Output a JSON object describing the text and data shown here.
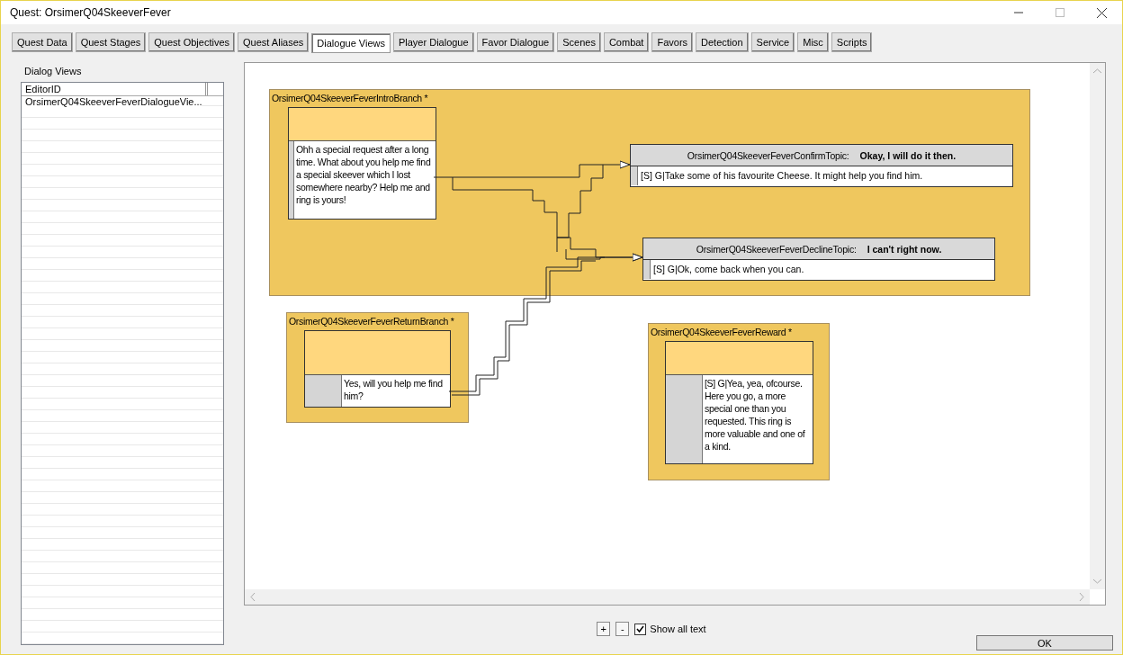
{
  "window": {
    "title": "Quest: OrsimerQ04SkeeverFever"
  },
  "tabs": [
    {
      "label": "Quest Data",
      "selected": false
    },
    {
      "label": "Quest Stages",
      "selected": false
    },
    {
      "label": "Quest Objectives",
      "selected": false
    },
    {
      "label": "Quest Aliases",
      "selected": false
    },
    {
      "label": "Dialogue Views",
      "selected": true
    },
    {
      "label": "Player Dialogue",
      "selected": false
    },
    {
      "label": "Favor Dialogue",
      "selected": false
    },
    {
      "label": "Scenes",
      "selected": false
    },
    {
      "label": "Combat",
      "selected": false
    },
    {
      "label": "Favors",
      "selected": false
    },
    {
      "label": "Detection",
      "selected": false
    },
    {
      "label": "Service",
      "selected": false
    },
    {
      "label": "Misc",
      "selected": false
    },
    {
      "label": "Scripts",
      "selected": false
    }
  ],
  "dialog_views": {
    "label": "Dialog Views",
    "columns": [
      "EditorID"
    ],
    "rows": [
      {
        "editor_id": "OrsimerQ04SkeeverFeverDialogueVie...",
        "selected": false
      }
    ]
  },
  "canvas": {
    "branches": [
      {
        "title": "OrsimerQ04SkeeverFeverIntroBranch *",
        "text": "Ohh a special request after a long time. What about you help me find a special skeever which I lost somewhere nearby? Help me and ring is yours!",
        "topics": [
          {
            "name": "OrsimerQ04SkeeverFeverConfirmTopic:",
            "prompt": "Okay, I will do it then.",
            "response": "[S] G|Take some of his favourite Cheese. It might help you find him."
          },
          {
            "name": "OrsimerQ04SkeeverFeverDeclineTopic:",
            "prompt": "I can't right now.",
            "response": "[S] G|Ok, come back when you can."
          }
        ]
      },
      {
        "title": "OrsimerQ04SkeeverFeverReturnBranch *",
        "text": "Yes, will you help me find him?"
      },
      {
        "title": "OrsimerQ04SkeeverFeverReward *",
        "text": "[S] G|Yea, yea, ofcourse. Here you go, a more special one than you requested. This ring is more valuable and one of a kind."
      }
    ]
  },
  "zoom_buttons": [
    "+",
    "-"
  ],
  "show_all_text": {
    "label": "Show all text",
    "checked": true
  },
  "ok_button": "OK"
}
